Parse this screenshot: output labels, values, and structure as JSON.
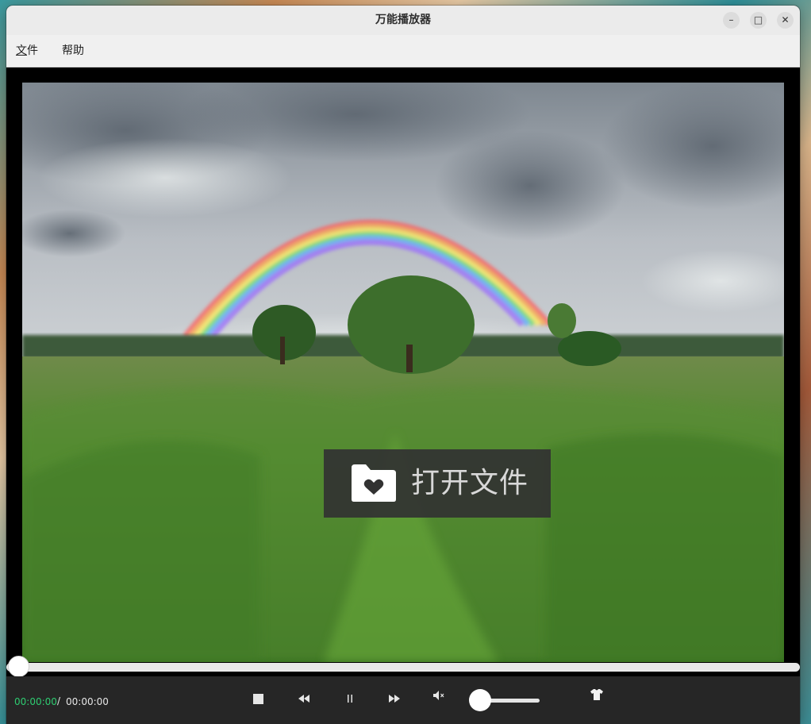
{
  "window": {
    "title": "万能播放器",
    "controls": {
      "minimize": "–",
      "maximize": "□",
      "close": "✕"
    }
  },
  "menu": {
    "file_mnemonic": "文",
    "file_rest": "件",
    "help": "帮助"
  },
  "video": {
    "open_file_label": "打开文件",
    "open_icon": "folder-heart-icon"
  },
  "playback": {
    "progress": 0,
    "current_time": "00:00:00",
    "separator": "/",
    "total_time": "00:00:00",
    "volume_level": 0,
    "muted": true
  },
  "icons": {
    "stop": "stop-icon",
    "rewind": "rewind-icon",
    "pause": "pause-icon",
    "fast_forward": "fast-forward-icon",
    "mute": "volume-mute-icon",
    "skin": "tshirt-icon"
  },
  "colors": {
    "time_current": "#2ecc71",
    "control_bar": "#262626",
    "overlay": "#323232"
  }
}
